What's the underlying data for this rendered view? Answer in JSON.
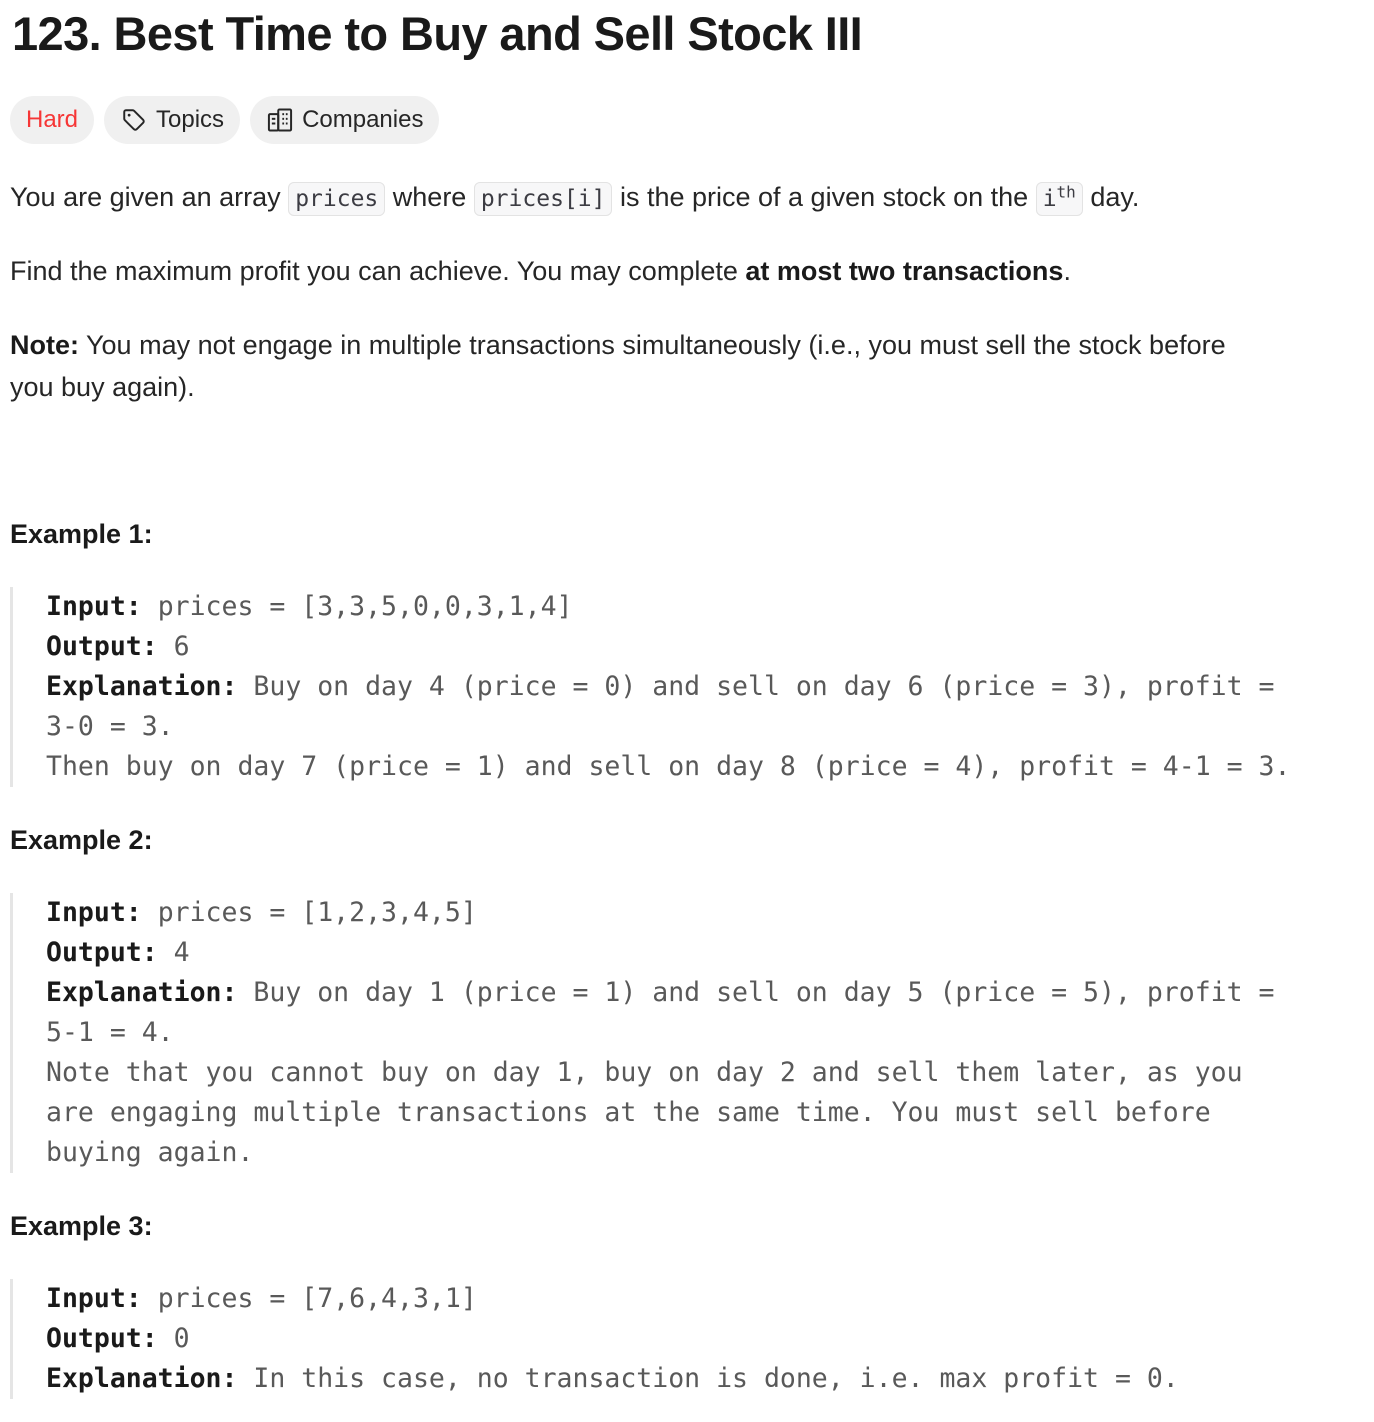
{
  "problem": {
    "title": "123. Best Time to Buy and Sell Stock III",
    "tags": {
      "difficulty": "Hard",
      "topics": "Topics",
      "companies": "Companies"
    },
    "colors": {
      "hard": "#f63636",
      "tag_bg": "#f0f0f0"
    },
    "icons": {
      "topics": "tag-icon",
      "companies": "building-icon"
    }
  },
  "description": {
    "p1": {
      "t1": "You are given an array ",
      "c1": "prices",
      "t2": " where ",
      "c2": "prices[i]",
      "t3": " is the price of a given stock on the ",
      "c3_base": "i",
      "c3_sup": "th",
      "t4": " day."
    },
    "p2": {
      "t1": "Find the maximum profit you can achieve. You may complete ",
      "b1": "at most two transactions",
      "t2": "."
    },
    "p3": {
      "b1": "Note:",
      "line1": " You may not engage in multiple transactions simultaneously (i.e., you must sell the stock before",
      "line2": "you buy again)."
    }
  },
  "examples": [
    {
      "title": "Example 1:",
      "input_label": "Input:",
      "input_value": " prices = [3,3,5,0,0,3,1,4]",
      "output_label": "Output:",
      "output_value": " 6",
      "explanation_label": "Explanation:",
      "explanation_lines": [
        " Buy on day 4 (price = 0) and sell on day 6 (price = 3), profit =",
        "3-0 = 3.",
        "Then buy on day 7 (price = 1) and sell on day 8 (price = 4), profit = 4-1 = 3."
      ]
    },
    {
      "title": "Example 2:",
      "input_label": "Input:",
      "input_value": " prices = [1,2,3,4,5]",
      "output_label": "Output:",
      "output_value": " 4",
      "explanation_label": "Explanation:",
      "explanation_lines": [
        " Buy on day 1 (price = 1) and sell on day 5 (price = 5), profit =",
        "5-1 = 4.",
        "Note that you cannot buy on day 1, buy on day 2 and sell them later, as you",
        "are engaging multiple transactions at the same time. You must sell before",
        "buying again."
      ]
    },
    {
      "title": "Example 3:",
      "input_label": "Input:",
      "input_value": " prices = [7,6,4,3,1]",
      "output_label": "Output:",
      "output_value": " 0",
      "explanation_label": "Explanation:",
      "explanation_lines": [
        " In this case, no transaction is done, i.e. max profit = 0."
      ]
    }
  ]
}
